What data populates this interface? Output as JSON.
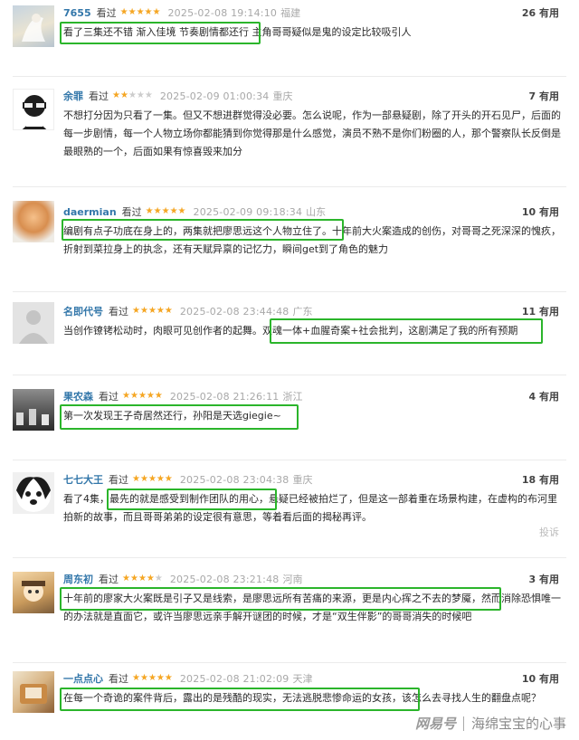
{
  "reviews": [
    {
      "user": "7655",
      "watched": "看过",
      "rating": 5,
      "time": "2025-02-08 19:14:10",
      "location": "福建",
      "useful": "26 有用",
      "text": "看了三集还不错 渐入佳境 节奏剧情都还行 主角哥哥疑似是鬼的设定比较吸引人",
      "avatar_colors": [
        "#b9c9d6",
        "#e8e2d0"
      ]
    },
    {
      "user": "余罪",
      "watched": "看过",
      "rating": 2,
      "time": "2025-02-09 01:00:34",
      "location": "重庆",
      "useful": "7 有用",
      "text": "不想打分因为只看了一集。但又不想进群觉得没必要。怎么说呢，作为一部悬疑剧，除了开头的开石见尸，后面的每一步剧情，每一个人物立场你都能猜到你觉得那是什么感觉，演员不熟不是你们粉圈的人，那个警察队长反倒是最眼熟的一个，后面如果有惊喜毁来加分",
      "avatar_colors": [
        "#ffffff",
        "#222222"
      ]
    },
    {
      "user": "daermian",
      "watched": "看过",
      "rating": 5,
      "time": "2025-02-09 09:18:34",
      "location": "山东",
      "useful": "10 有用",
      "text": "编剧有点子功底在身上的，两集就把廖思远这个人物立住了。十年前大火案造成的创伤，对哥哥之死深深的愧疚，折射到菜拉身上的执念，还有天赋异禀的记忆力，瞬间get到了角色的魅力",
      "avatar_colors": [
        "#e2a86a",
        "#f3f0ea"
      ]
    },
    {
      "user": "名即代号",
      "watched": "看过",
      "rating": 5,
      "time": "2025-02-08 23:44:48",
      "location": "广东",
      "useful": "11 有用",
      "text": "当创作镣铐松动时，肉眼可见创作者的起舞。双魂一体+血腥奇案+社会批判，这剧满足了我的所有预期",
      "avatar_colors": [
        "#d9d9d9",
        "#bfbfbf"
      ]
    },
    {
      "user": "果农森",
      "watched": "看过",
      "rating": 5,
      "time": "2025-02-08 21:26:11",
      "location": "浙江",
      "useful": "4 有用",
      "text": "第一次发现王子奇居然还行，孙阳是天选giegie~",
      "avatar_colors": [
        "#777777",
        "#2f2f2f"
      ]
    },
    {
      "user": "七七大王",
      "watched": "看过",
      "rating": 5,
      "time": "2025-02-08 23:04:38",
      "location": "重庆",
      "useful": "18 有用",
      "text": "看了4集，最先的就是感受到制作团队的用心，悬疑已经被拍烂了，但是这一部着重在场景构建，在虚构的布河里拍新的故事，而且哥哥弟弟的设定很有意思，等着看后面的揭秘再评。",
      "avatar_colors": [
        "#f2f2f2",
        "#1f1f1f"
      ],
      "report": "投诉"
    },
    {
      "user": "周东初",
      "watched": "看过",
      "rating": 4,
      "time": "2025-02-08 23:21:48",
      "location": "河南",
      "useful": "3 有用",
      "text": "十年前的廖家大火案既是引子又是线索，是廖思远所有苦痛的来源，更是内心挥之不去的梦魇，然而消除恐惧唯一的办法就是直面它，或许当廖思远亲手解开谜团的时候，才是“双生伴影”的哥哥消失的时候吧",
      "avatar_colors": [
        "#c8a15a",
        "#7a5b3a"
      ]
    },
    {
      "user": "一点点心",
      "watched": "看过",
      "rating": 5,
      "time": "2025-02-08 21:02:09",
      "location": "天津",
      "useful": "10 有用",
      "text": "在每一个奇诡的案件背后，露出的是残酷的现实，无法逃脱悲惨命运的女孩，该怎么去寻找人生的翻盘点呢？",
      "avatar_colors": [
        "#d8b483",
        "#8b5e34"
      ]
    }
  ],
  "watermark": {
    "logo": "网易号",
    "source": "海绵宝宝的心事"
  },
  "colors": {
    "username": "#3377aa",
    "star": "#f5a623",
    "highlight": "#2bb52b"
  }
}
